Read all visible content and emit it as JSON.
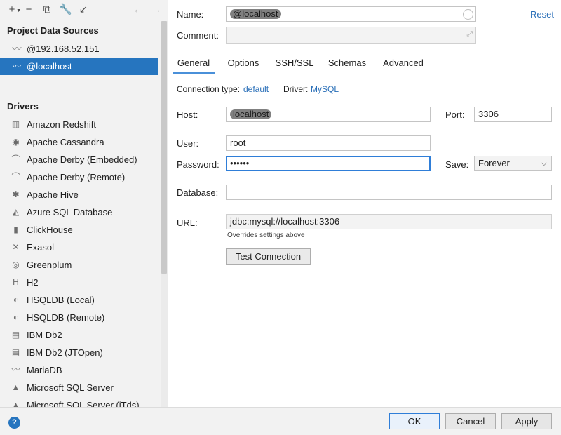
{
  "toolbar": {
    "icons": [
      "add-icon",
      "remove-icon",
      "duplicate-icon",
      "wrench-icon",
      "import-icon",
      "back-icon",
      "forward-icon"
    ]
  },
  "sidebar": {
    "project_title": "Project Data Sources",
    "data_sources": [
      {
        "label": "@192.168.52.151",
        "icon": "mysql-dolphin-icon"
      },
      {
        "label": "@localhost",
        "icon": "mysql-dolphin-icon",
        "selected": true
      }
    ],
    "drivers_title": "Drivers",
    "drivers": [
      {
        "label": "Amazon Redshift",
        "icon": "redshift-icon"
      },
      {
        "label": "Apache Cassandra",
        "icon": "cassandra-eye-icon"
      },
      {
        "label": "Apache Derby (Embedded)",
        "icon": "derby-hat-icon"
      },
      {
        "label": "Apache Derby (Remote)",
        "icon": "derby-hat-icon"
      },
      {
        "label": "Apache Hive",
        "icon": "hive-bee-icon"
      },
      {
        "label": "Azure SQL Database",
        "icon": "azure-icon"
      },
      {
        "label": "ClickHouse",
        "icon": "clickhouse-bars-icon"
      },
      {
        "label": "Exasol",
        "icon": "exasol-x-icon"
      },
      {
        "label": "Greenplum",
        "icon": "greenplum-icon"
      },
      {
        "label": "H2",
        "icon": "h2-icon"
      },
      {
        "label": "HSQLDB (Local)",
        "icon": "hsqldb-icon"
      },
      {
        "label": "HSQLDB (Remote)",
        "icon": "hsqldb-icon"
      },
      {
        "label": "IBM Db2",
        "icon": "ibm-db2-icon"
      },
      {
        "label": "IBM Db2 (JTOpen)",
        "icon": "ibm-db2-icon"
      },
      {
        "label": "MariaDB",
        "icon": "mariadb-seal-icon"
      },
      {
        "label": "Microsoft SQL Server",
        "icon": "sqlserver-icon"
      },
      {
        "label": "Microsoft SQL Server (jTds)",
        "icon": "sqlserver-icon"
      }
    ]
  },
  "form": {
    "name_label": "Name:",
    "name_value": "@localhost",
    "reset_label": "Reset",
    "comment_label": "Comment:",
    "comment_value": "",
    "tabs": [
      "General",
      "Options",
      "SSH/SSL",
      "Schemas",
      "Advanced"
    ],
    "active_tab": "General",
    "connection_type_label": "Connection type:",
    "connection_type_value": "default",
    "driver_label": "Driver:",
    "driver_value": "MySQL",
    "host_label": "Host:",
    "host_value": "localhost",
    "port_label": "Port:",
    "port_value": "3306",
    "user_label": "User:",
    "user_value": "root",
    "password_label": "Password:",
    "password_value": "••••••",
    "save_label": "Save:",
    "save_value": "Forever",
    "database_label": "Database:",
    "database_value": "",
    "url_label": "URL:",
    "url_value": "jdbc:mysql://localhost:3306",
    "url_note": "Overrides settings above",
    "test_button": "Test Connection"
  },
  "footer": {
    "help": "?",
    "ok": "OK",
    "cancel": "Cancel",
    "apply": "Apply"
  }
}
